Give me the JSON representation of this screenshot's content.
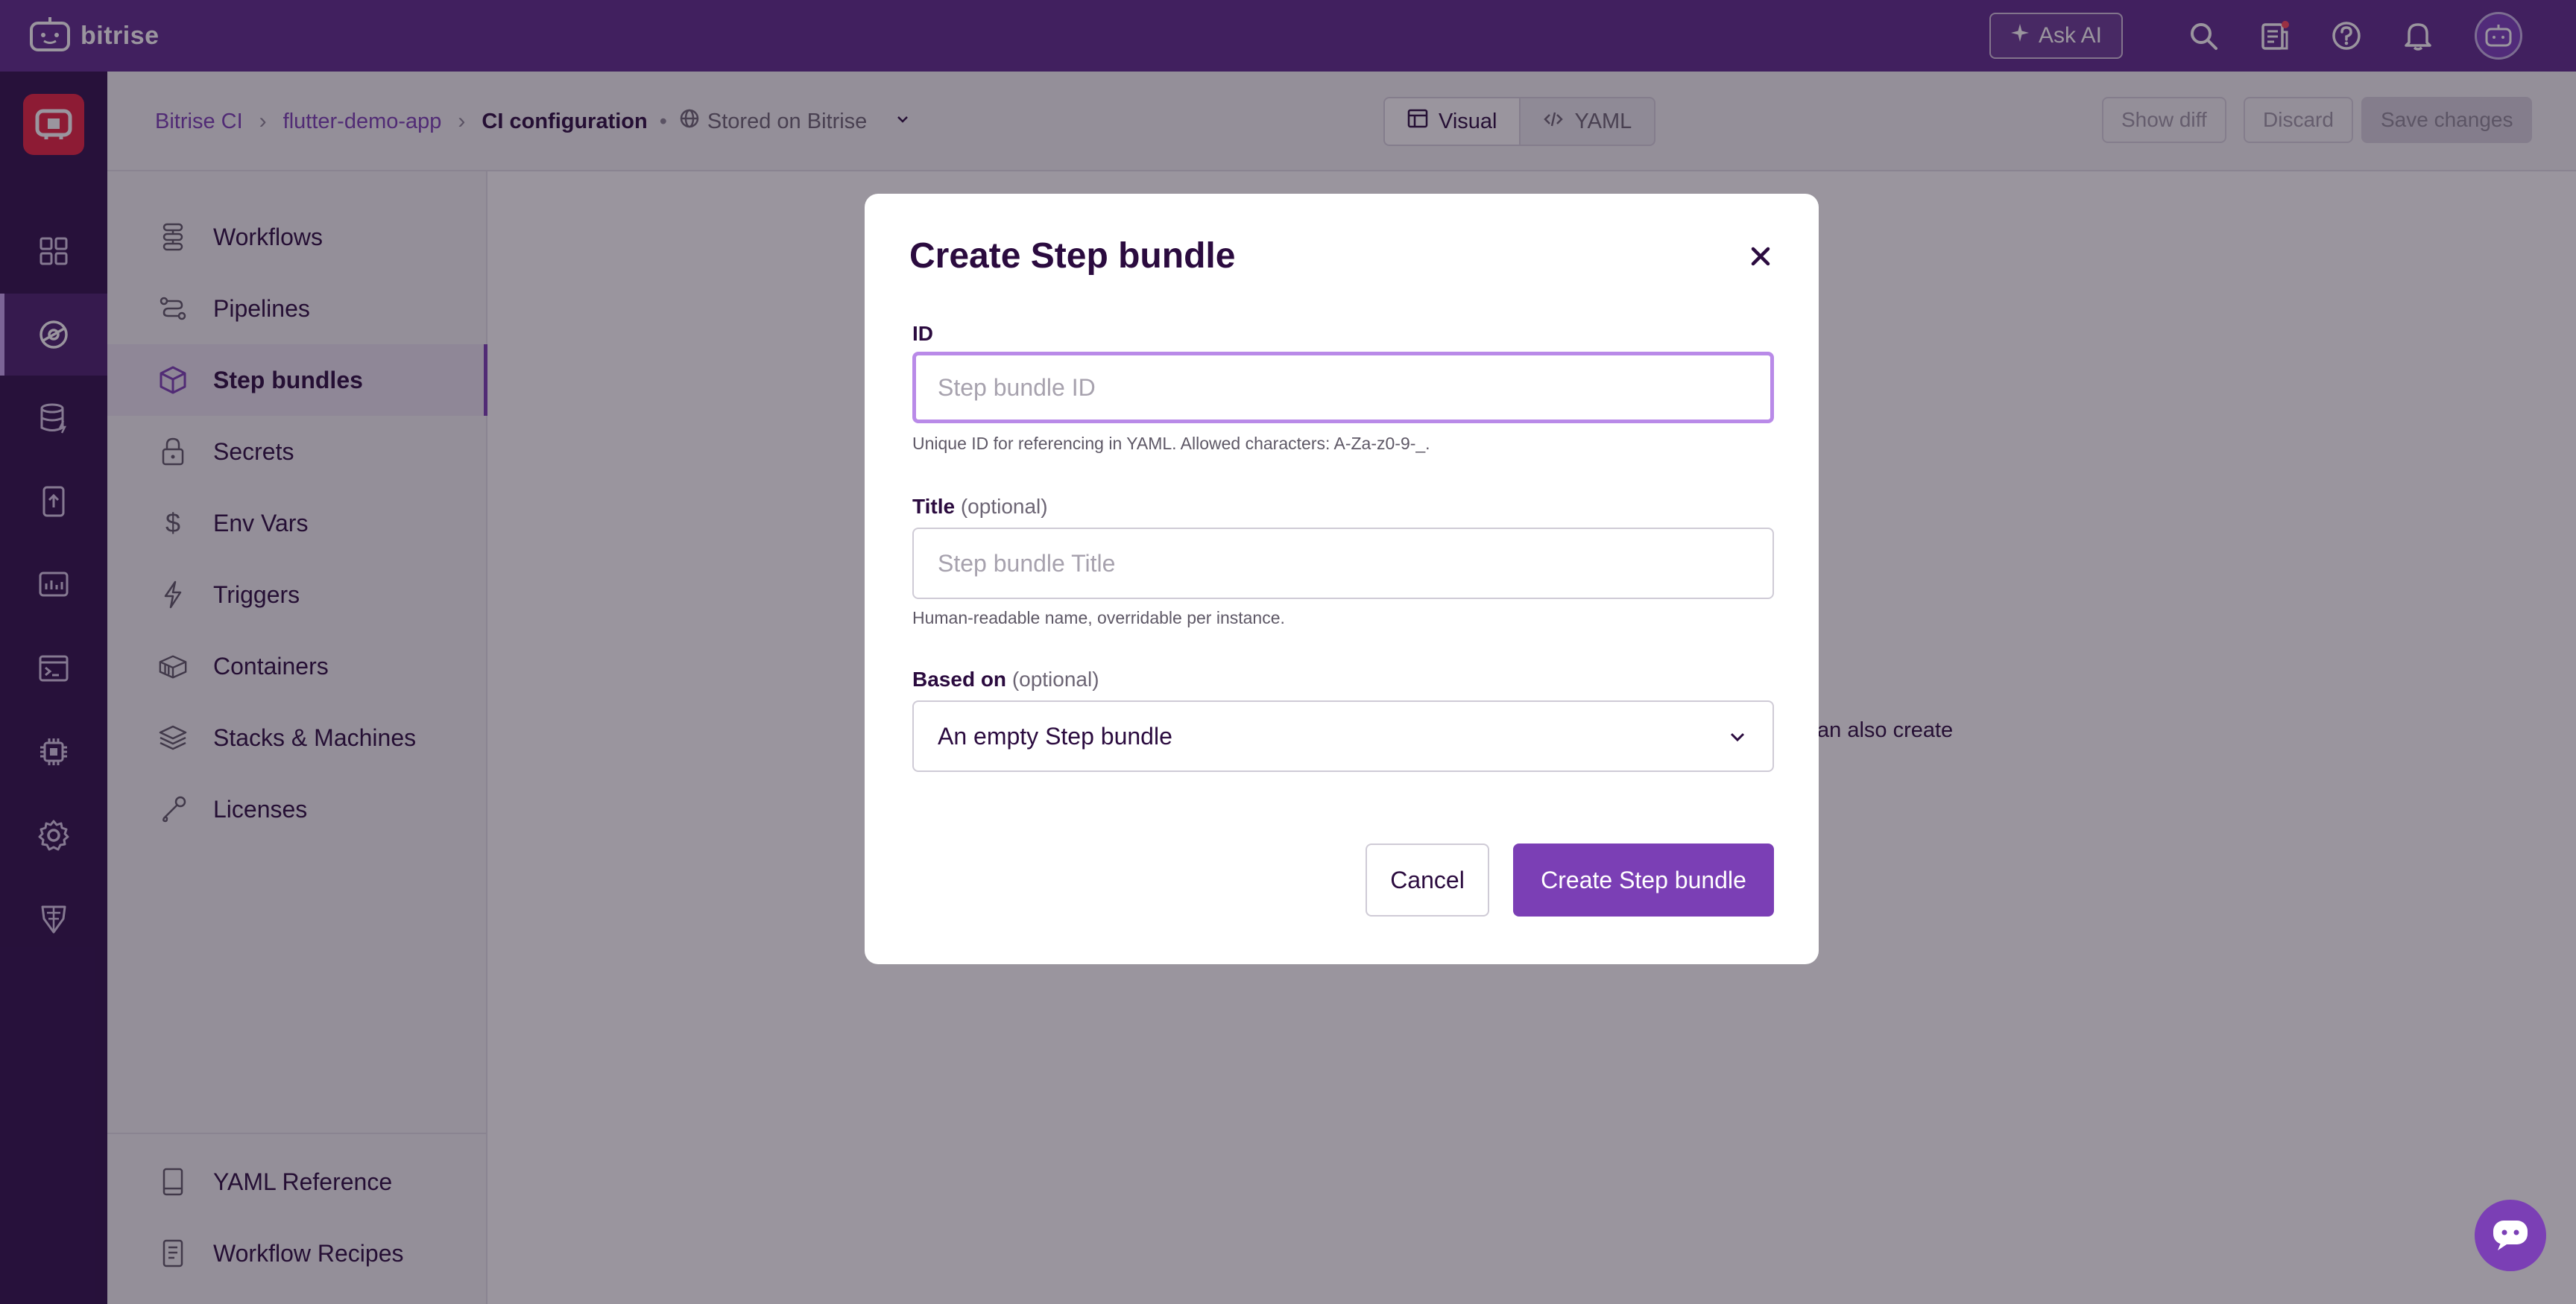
{
  "topbar": {
    "brand": "bitrise",
    "ask_ai": "Ask AI",
    "icons": [
      "search-icon",
      "changelog-icon",
      "help-icon",
      "bell-icon",
      "avatar"
    ]
  },
  "rail": {
    "items": [
      "dashboard-icon",
      "ci-icon",
      "cache-icon",
      "release-icon",
      "insights-icon",
      "terminal-icon",
      "chip-icon",
      "settings-icon",
      "robot-icon"
    ],
    "active_index": 1
  },
  "header": {
    "breadcrumb": [
      "Bitrise CI",
      "flutter-demo-app",
      "CI configuration"
    ],
    "stored": "Stored on Bitrise",
    "view_visual": "Visual",
    "view_yaml": "YAML",
    "show_diff": "Show diff",
    "discard": "Discard",
    "save_changes": "Save changes"
  },
  "sidebar": {
    "items": [
      {
        "label": "Workflows",
        "icon": "workflows-icon"
      },
      {
        "label": "Pipelines",
        "icon": "pipelines-icon"
      },
      {
        "label": "Step bundles",
        "icon": "cube-icon"
      },
      {
        "label": "Secrets",
        "icon": "lock-icon"
      },
      {
        "label": "Env Vars",
        "icon": "dollar-icon"
      },
      {
        "label": "Triggers",
        "icon": "bolt-icon"
      },
      {
        "label": "Containers",
        "icon": "container-icon"
      },
      {
        "label": "Stacks & Machines",
        "icon": "layers-icon"
      },
      {
        "label": "Licenses",
        "icon": "key-icon"
      }
    ],
    "active_index": 2,
    "bottom": [
      {
        "label": "YAML Reference",
        "icon": "book-icon"
      },
      {
        "label": "Workflow Recipes",
        "icon": "recipe-icon"
      }
    ]
  },
  "main": {
    "partial_text": "an also create"
  },
  "modal": {
    "title": "Create Step bundle",
    "id_label": "ID",
    "id_placeholder": "Step bundle ID",
    "id_help": "Unique ID for referencing in YAML. Allowed characters: A-Za-z0-9-_.",
    "title_label": "Title",
    "title_optional": "(optional)",
    "title_placeholder": "Step bundle Title",
    "title_help": "Human-readable name, overridable per instance.",
    "based_label": "Based on",
    "based_optional": "(optional)",
    "based_value": "An empty Step bundle",
    "cancel": "Cancel",
    "create": "Create Step bundle"
  },
  "colors": {
    "brand_purple": "#5e2b8c",
    "rail_bg": "#2e0f4a",
    "accent": "#7b3fb5",
    "logo_red": "#e8223f",
    "focus_ring": "#b98ae8"
  }
}
